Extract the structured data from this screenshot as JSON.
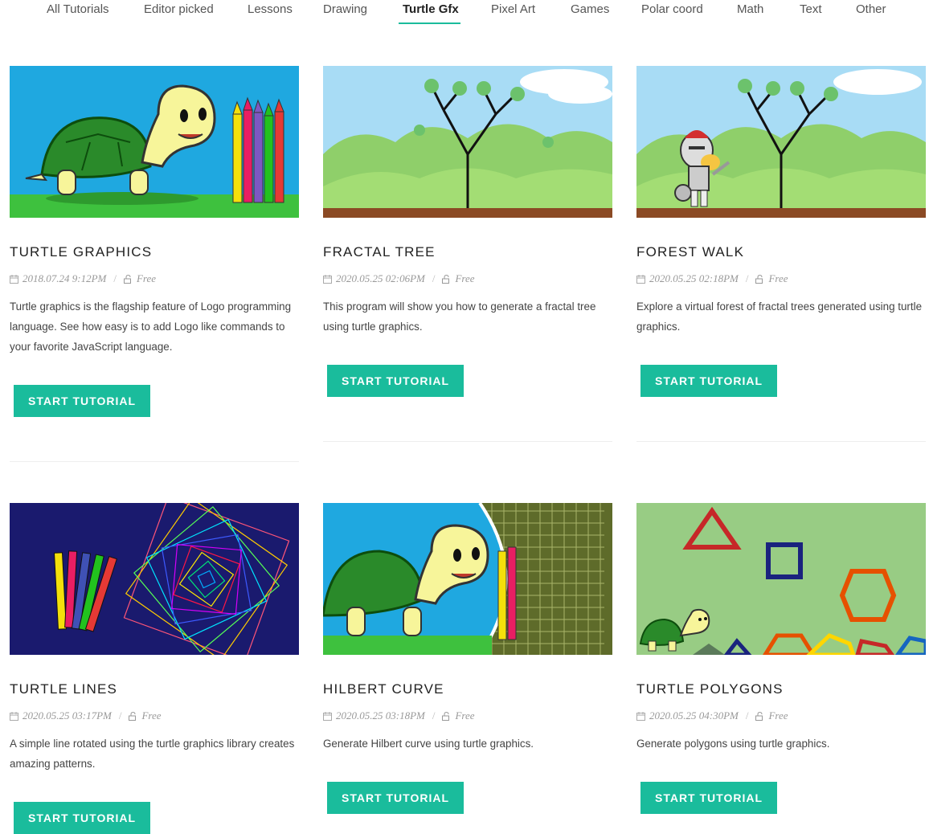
{
  "tabs": [
    {
      "label": "All Tutorials"
    },
    {
      "label": "Editor picked"
    },
    {
      "label": "Lessons"
    },
    {
      "label": "Drawing"
    },
    {
      "label": "Turtle Gfx"
    },
    {
      "label": "Pixel Art"
    },
    {
      "label": "Games"
    },
    {
      "label": "Polar coord"
    },
    {
      "label": "Math"
    },
    {
      "label": "Text"
    },
    {
      "label": "Other"
    }
  ],
  "active_tab": "Turtle Gfx",
  "accent_color": "#1abc9c",
  "cards": [
    {
      "title": "TURTLE GRAPHICS",
      "date": "2018.07.24 9:12PM",
      "price": "Free",
      "description": "Turtle graphics is the flagship feature of Logo programming language. See how easy is to add Logo like commands to your favorite JavaScript language.",
      "button": "START TUTORIAL"
    },
    {
      "title": "FRACTAL TREE",
      "date": "2020.05.25 02:06PM",
      "price": "Free",
      "description": "This program will show you how to generate a fractal tree using turtle graphics.",
      "button": "START TUTORIAL"
    },
    {
      "title": "FOREST WALK",
      "date": "2020.05.25 02:18PM",
      "price": "Free",
      "description": "Explore a virtual forest of fractal trees generated using turtle graphics.",
      "button": "START TUTORIAL"
    },
    {
      "title": "TURTLE LINES",
      "date": "2020.05.25 03:17PM",
      "price": "Free",
      "description": "A simple line rotated using the turtle graphics library creates amazing patterns.",
      "button": "START TUTORIAL"
    },
    {
      "title": "HILBERT CURVE",
      "date": "2020.05.25 03:18PM",
      "price": "Free",
      "description": "Generate Hilbert curve using turtle graphics.",
      "button": "START TUTORIAL"
    },
    {
      "title": "TURTLE POLYGONS",
      "date": "2020.05.25 04:30PM",
      "price": "Free",
      "description": "Generate polygons using turtle graphics.",
      "button": "START TUTORIAL"
    }
  ]
}
